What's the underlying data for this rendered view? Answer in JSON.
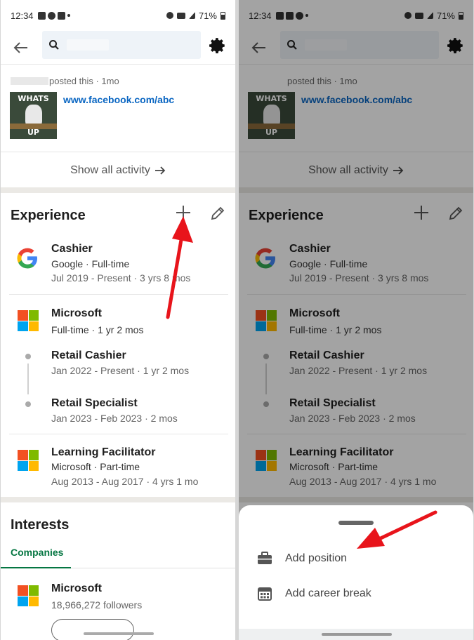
{
  "status_bar": {
    "time": "12:34",
    "battery": "71%"
  },
  "search": {
    "placeholder": ""
  },
  "post": {
    "meta": "posted this · 1mo",
    "thumbnail_text_top": "WHATS",
    "thumbnail_text_bottom": "UP",
    "link": "www.facebook.com/abc",
    "show_all_label": "Show all activity"
  },
  "experience": {
    "title": "Experience",
    "jobs": [
      {
        "title": "Cashier",
        "subtitle": "Google · Full-time",
        "dates": "Jul 2019 - Present · 3 yrs 8 mos"
      },
      {
        "title": "Microsoft",
        "subtitle": "Full-time · 1 yr 2 mos"
      },
      {
        "title": "Retail Cashier",
        "dates": "Jan 2022 - Present · 1 yr 2 mos"
      },
      {
        "title": "Retail Specialist",
        "dates": "Jan 2023 - Feb 2023 · 2 mos"
      },
      {
        "title": "Learning Facilitator",
        "subtitle": "Microsoft · Part-time",
        "dates": "Aug 2013 - Aug 2017 · 4 yrs 1 mo"
      }
    ]
  },
  "interests": {
    "title": "Interests",
    "tab": "Companies",
    "company": {
      "name": "Microsoft",
      "followers": "18,966,272 followers"
    }
  },
  "sheet": {
    "items": [
      {
        "label": "Add position",
        "icon": "briefcase-icon"
      },
      {
        "label": "Add career break",
        "icon": "calendar-icon"
      }
    ]
  },
  "colors": {
    "link_blue": "#0a66c2",
    "linkedin_green": "#057642",
    "annotation_red": "#e8141b",
    "ms_red": "#f25022",
    "ms_green": "#7fba00",
    "ms_blue": "#00a4ef",
    "ms_yellow": "#ffb900"
  }
}
